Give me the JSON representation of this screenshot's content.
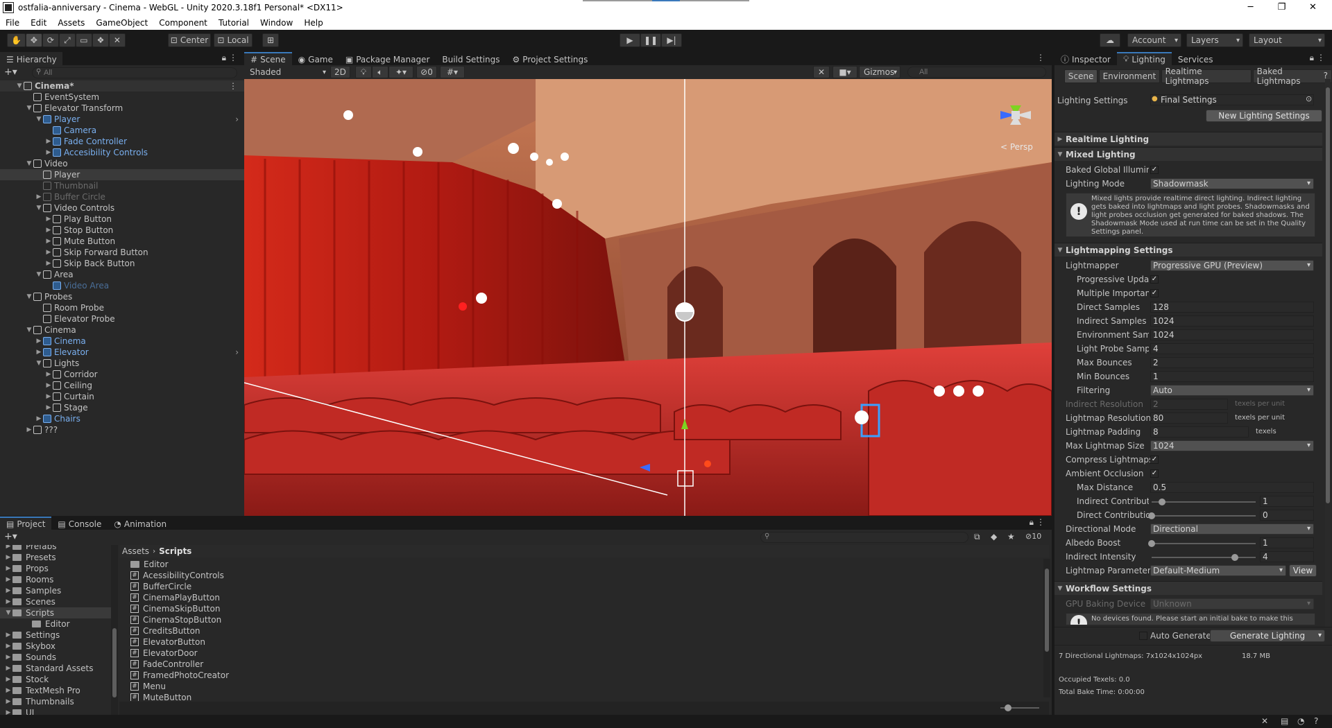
{
  "window": {
    "title": "ostfalia-anniversary - Cinema - WebGL - Unity 2020.3.18f1 Personal* <DX11>",
    "minimize": "─",
    "maximize": "❐",
    "close": "✕"
  },
  "menu": [
    "File",
    "Edit",
    "Assets",
    "GameObject",
    "Component",
    "Tutorial",
    "Window",
    "Help"
  ],
  "toolbar": {
    "pivot": "Center",
    "space": "Local",
    "account": "Account",
    "layers": "Layers",
    "layout": "Layout"
  },
  "hierarchy": {
    "tab": "Hierarchy",
    "search_placeholder": "All",
    "rows": [
      {
        "label": "Cinema*",
        "depth": 0,
        "style": "scene"
      },
      {
        "label": "EventSystem",
        "depth": 1,
        "style": "normal"
      },
      {
        "label": "Elevator Transform",
        "depth": 1,
        "style": "normal"
      },
      {
        "label": "Player",
        "depth": 2,
        "style": "blue"
      },
      {
        "label": "Camera",
        "depth": 3,
        "style": "blue"
      },
      {
        "label": "Fade Controller",
        "depth": 3,
        "style": "blue"
      },
      {
        "label": "Accesibility Controls",
        "depth": 3,
        "style": "blue"
      },
      {
        "label": "Video",
        "depth": 1,
        "style": "normal"
      },
      {
        "label": "Player",
        "depth": 2,
        "style": "selected"
      },
      {
        "label": "Thumbnail",
        "depth": 2,
        "style": "dim"
      },
      {
        "label": "Buffer Circle",
        "depth": 2,
        "style": "dim"
      },
      {
        "label": "Video Controls",
        "depth": 2,
        "style": "normal"
      },
      {
        "label": "Play Button",
        "depth": 3,
        "style": "normal"
      },
      {
        "label": "Stop Button",
        "depth": 3,
        "style": "normal"
      },
      {
        "label": "Mute Button",
        "depth": 3,
        "style": "normal"
      },
      {
        "label": "Skip Forward Button",
        "depth": 3,
        "style": "normal"
      },
      {
        "label": "Skip Back Button",
        "depth": 3,
        "style": "normal"
      },
      {
        "label": "Area",
        "depth": 2,
        "style": "normal"
      },
      {
        "label": "Video Area",
        "depth": 3,
        "style": "bluedim"
      },
      {
        "label": "Probes",
        "depth": 1,
        "style": "normal"
      },
      {
        "label": "Room Probe",
        "depth": 2,
        "style": "normal"
      },
      {
        "label": "Elevator Probe",
        "depth": 2,
        "style": "normal"
      },
      {
        "label": "Cinema",
        "depth": 1,
        "style": "normal"
      },
      {
        "label": "Cinema",
        "depth": 2,
        "style": "blue"
      },
      {
        "label": "Elevator",
        "depth": 2,
        "style": "blue"
      },
      {
        "label": "Lights",
        "depth": 2,
        "style": "normal"
      },
      {
        "label": "Corridor",
        "depth": 3,
        "style": "normal"
      },
      {
        "label": "Ceiling",
        "depth": 3,
        "style": "normal"
      },
      {
        "label": "Curtain",
        "depth": 3,
        "style": "normal"
      },
      {
        "label": "Stage",
        "depth": 3,
        "style": "normal"
      },
      {
        "label": "Chairs",
        "depth": 2,
        "style": "blue"
      },
      {
        "label": "???",
        "depth": 1,
        "style": "normal"
      }
    ]
  },
  "scene": {
    "tabs": [
      "Scene",
      "Game",
      "Package Manager",
      "Build Settings",
      "Project Settings"
    ],
    "shading": "Shaded",
    "mode2d": "2D",
    "hidden_count": "0",
    "gizmos": "Gizmos",
    "search_placeholder": "All",
    "persp": "< Persp"
  },
  "inspector": {
    "tabs": [
      "Inspector",
      "Lighting",
      "Services"
    ],
    "subtabs": [
      "Scene",
      "Environment",
      "Realtime Lightmaps",
      "Baked Lightmaps"
    ],
    "lighting_settings_label": "Lighting Settings",
    "lighting_settings_value": "Final Settings",
    "new_button": "New Lighting Settings",
    "realtime": "Realtime Lighting",
    "mixed": "Mixed Lighting",
    "baked_gi": "Baked Global Illumina",
    "lighting_mode": "Lighting Mode",
    "lighting_mode_value": "Shadowmask",
    "mixed_help": "Mixed lights provide realtime direct lighting. Indirect lighting gets baked into lightmaps and light probes. Shadowmasks and light probes occlusion get generated for baked shadows. The Shadowmask Mode used at run time can be set in the Quality Settings panel.",
    "lightmapping": "Lightmapping Settings",
    "lightmapper": "Lightmapper",
    "lightmapper_value": "Progressive GPU (Preview)",
    "progressive_updates": "Progressive Updat",
    "multiple_importance": "Multiple Importanc",
    "direct_samples": "Direct Samples",
    "direct_samples_value": "128",
    "indirect_samples": "Indirect Samples",
    "indirect_samples_value": "1024",
    "env_samples": "Environment Samp",
    "env_samples_value": "1024",
    "probe_samples": "Light Probe Sampl",
    "probe_samples_value": "4",
    "max_bounces": "Max Bounces",
    "max_bounces_value": "2",
    "min_bounces": "Min Bounces",
    "min_bounces_value": "1",
    "filtering": "Filtering",
    "filtering_value": "Auto",
    "indirect_res": "Indirect Resolution",
    "indirect_res_value": "2",
    "texels_per_unit": "texels per unit",
    "lightmap_res": "Lightmap Resolution",
    "lightmap_res_value": "80",
    "lightmap_pad": "Lightmap Padding",
    "lightmap_pad_value": "8",
    "texels": "texels",
    "max_size": "Max Lightmap Size",
    "max_size_value": "1024",
    "compress": "Compress Lightmaps",
    "ao": "Ambient Occlusion",
    "max_distance": "Max Distance",
    "max_distance_value": "0.5",
    "indirect_contrib": "Indirect Contributic",
    "indirect_contrib_value": "1",
    "indirect_contrib_level": 0.1,
    "direct_contrib": "Direct Contributior",
    "direct_contrib_value": "0",
    "direct_contrib_level": 0,
    "dir_mode": "Directional Mode",
    "dir_mode_value": "Directional",
    "albedo": "Albedo Boost",
    "albedo_value": "1",
    "albedo_level": 0,
    "indirect_intensity": "Indirect Intensity",
    "indirect_intensity_value": "4",
    "indirect_intensity_level": 0.8,
    "lm_params": "Lightmap Parameters",
    "lm_params_value": "Default-Medium",
    "view_button": "View",
    "workflow": "Workflow Settings",
    "gpu_device": "GPU Baking Device",
    "gpu_device_value": "Unknown",
    "gpu_help": "No devices found. Please start an initial bake to make this",
    "auto_generate": "Auto Generate",
    "generate": "Generate Lighting",
    "stats_lightmaps": "7 Directional Lightmaps: 7x1024x1024px",
    "stats_size": "18.7 MB",
    "occupied": "Occupied Texels: 0.0",
    "bake_time": "Total Bake Time: 0:00:00"
  },
  "project": {
    "tabs": [
      "Project",
      "Console",
      "Animation"
    ],
    "folders": [
      "Prefabs",
      "Presets",
      "Props",
      "Rooms",
      "Samples",
      "Scenes",
      "Scripts",
      "Editor",
      "Settings",
      "Skybox",
      "Sounds",
      "Standard Assets",
      "Stock",
      "TextMesh Pro",
      "Thumbnails",
      "UI"
    ],
    "breadcrumb_root": "Assets",
    "breadcrumb_current": "Scripts",
    "hidden_count": "10",
    "files": [
      "Editor",
      "AcessibilityControls",
      "BufferCircle",
      "CinemaPlayButton",
      "CinemaSkipButton",
      "CinemaStopButton",
      "CreditsButton",
      "ElevatorButton",
      "ElevatorDoor",
      "FadeController",
      "FramedPhotoCreator",
      "Menu",
      "MuteButton"
    ]
  },
  "colors": {
    "accent": "#3a79bb",
    "curtain": "#b81c14",
    "selected_tab_border": "#3a79bb"
  }
}
